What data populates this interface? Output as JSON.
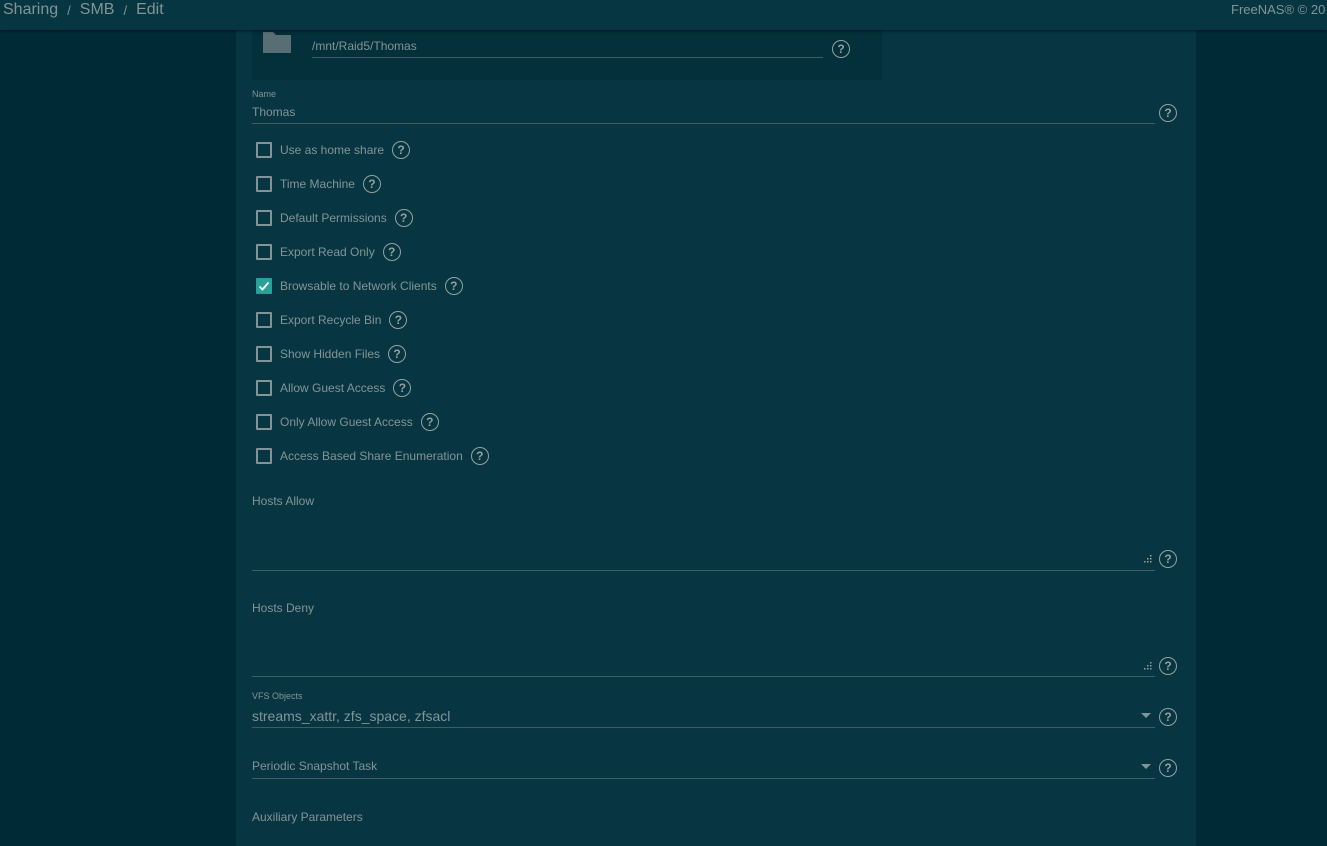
{
  "breadcrumb": [
    "Sharing",
    "SMB",
    "Edit"
  ],
  "copyright": "FreeNAS® © 20",
  "path": {
    "value": "/mnt/Raid5/Thomas"
  },
  "name_field": {
    "label": "Name",
    "value": "Thomas"
  },
  "checkboxes": [
    {
      "label": "Use as home share",
      "checked": false
    },
    {
      "label": "Time Machine",
      "checked": false
    },
    {
      "label": "Default Permissions",
      "checked": false
    },
    {
      "label": "Export Read Only",
      "checked": false
    },
    {
      "label": "Browsable to Network Clients",
      "checked": true
    },
    {
      "label": "Export Recycle Bin",
      "checked": false
    },
    {
      "label": "Show Hidden Files",
      "checked": false
    },
    {
      "label": "Allow Guest Access",
      "checked": false
    },
    {
      "label": "Only Allow Guest Access",
      "checked": false
    },
    {
      "label": "Access Based Share Enumeration",
      "checked": false
    }
  ],
  "hosts_allow": {
    "label": "Hosts Allow",
    "value": ""
  },
  "hosts_deny": {
    "label": "Hosts Deny",
    "value": ""
  },
  "vfs_objects": {
    "label": "VFS Objects",
    "value": "streams_xattr, zfs_space, zfsacl"
  },
  "periodic_snapshot": {
    "label": "Periodic Snapshot Task",
    "value": ""
  },
  "auxiliary": {
    "label": "Auxiliary Parameters"
  },
  "colors": {
    "background": "#002b36",
    "card": "#073642",
    "accent": "#2aa198",
    "text": "#839496"
  }
}
